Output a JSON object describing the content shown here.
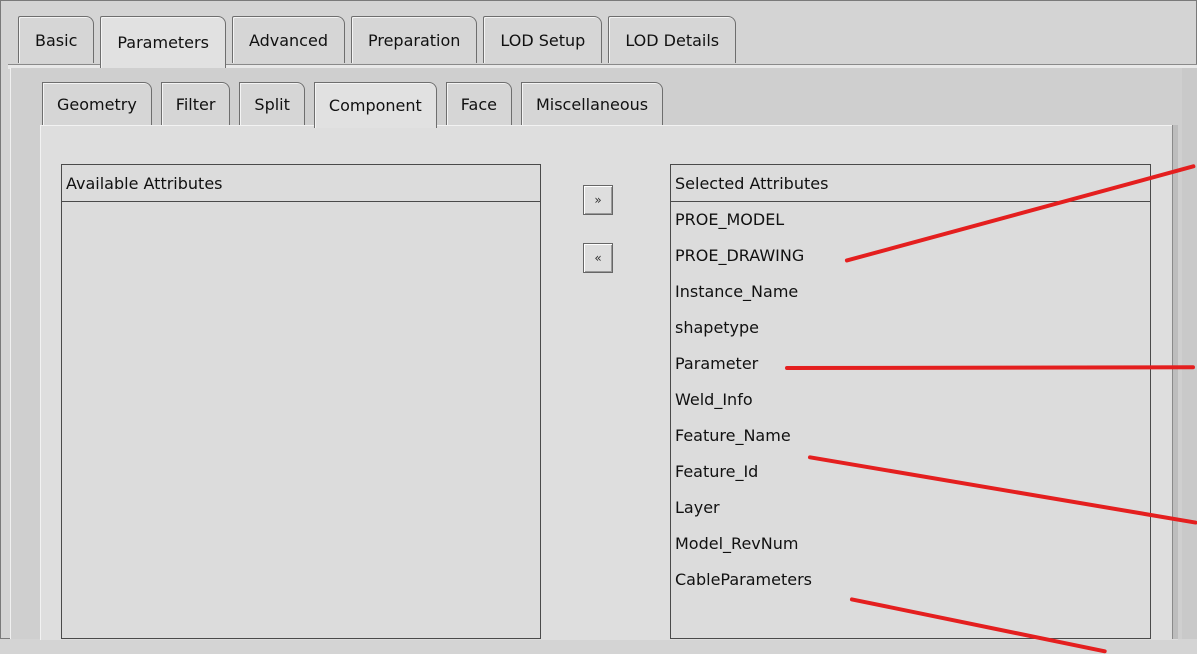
{
  "tabs": [
    "Basic",
    "Parameters",
    "Advanced",
    "Preparation",
    "LOD Setup",
    "LOD Details"
  ],
  "subtabs": [
    "Geometry",
    "Filter",
    "Split",
    "Component",
    "Face",
    "Miscellaneous"
  ],
  "available": {
    "header": "Available Attributes"
  },
  "selected": {
    "header": "Selected Attributes",
    "items": [
      "PROE_MODEL",
      "PROE_DRAWING",
      "Instance_Name",
      "shapetype",
      "Parameter",
      "Weld_Info",
      "Feature_Name",
      "Feature_Id",
      "Layer",
      "Model_RevNum",
      "CableParameters"
    ]
  },
  "buttons": {
    "add": "»",
    "remove": "«"
  },
  "colors": {
    "annotation": "#e41f1f"
  }
}
